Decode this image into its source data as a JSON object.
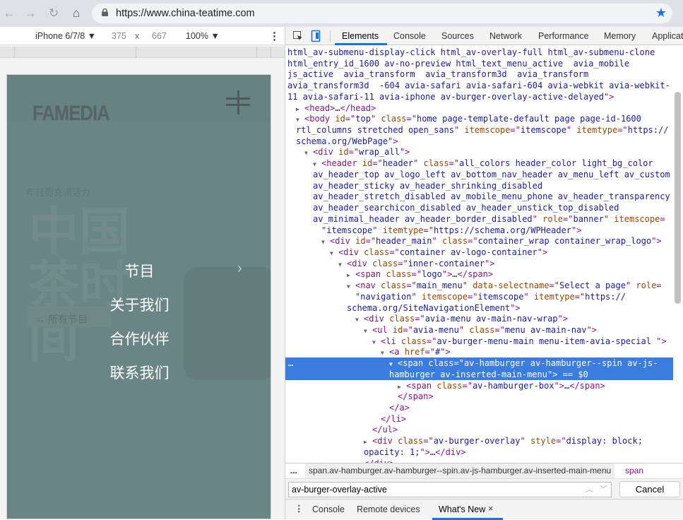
{
  "browser": {
    "url": "https://www.china-teatime.com",
    "back_icon": "arrow-left",
    "forward_icon": "arrow-right",
    "reload_icon": "reload",
    "home_icon": "home",
    "bookmark_icon": "star",
    "accent": "#1a73e8"
  },
  "device_toolbar": {
    "device": "iPhone 6/7/8 ▼",
    "width": "375",
    "x": "x",
    "height": "667",
    "zoom": "100% ▼",
    "more": "⋮"
  },
  "page": {
    "logo": "FAMEDIA",
    "tagline": "年轻而充满活力",
    "hero": "中国茶时间",
    "all_programs": "→ 所有节目",
    "overlay_color": "#6a8585",
    "menu": [
      {
        "label": "节目",
        "has_submenu": true,
        "chevron": "›"
      },
      {
        "label": "关于我们"
      },
      {
        "label": "合作伙伴"
      },
      {
        "label": "联系我们"
      }
    ]
  },
  "devtools": {
    "tabs": [
      "Elements",
      "Console",
      "Sources",
      "Network",
      "Performance",
      "Memory",
      "Applicat"
    ],
    "active_tab": "Elements",
    "lines": [
      {
        "d": 0,
        "s": [
          [
            "v",
            "html_av-submenu-display-click html_av-overlay-full html_av-submenu-clone"
          ]
        ]
      },
      {
        "d": 0,
        "s": [
          [
            "v",
            "html_entry_id_1600 av-no-preview html_text_menu_active  avia_mobile"
          ]
        ]
      },
      {
        "d": 0,
        "s": [
          [
            "v",
            "js_active  avia_transform  avia_transform3d  avia_transform"
          ]
        ]
      },
      {
        "d": 0,
        "s": [
          [
            "v",
            "avia_transform3d  -604 avia-safari avia-safari-604 avia-webkit avia-webkit-"
          ]
        ]
      },
      {
        "d": 0,
        "s": [
          [
            "v",
            "11 avia-safari-11 avia-iphone av-burger-overlay-active-delayed"
          ],
          [
            "t",
            "\">"
          ]
        ]
      },
      {
        "d": 1,
        "tri": "▶",
        "s": [
          [
            "t",
            "<head>"
          ],
          [
            "x",
            "…"
          ],
          [
            "t",
            "</head>"
          ]
        ]
      },
      {
        "d": 1,
        "tri": "▼",
        "s": [
          [
            "t",
            "<body "
          ],
          [
            "a",
            "id"
          ],
          [
            "t",
            "=\""
          ],
          [
            "v",
            "top"
          ],
          [
            "t",
            "\" "
          ],
          [
            "a",
            "class"
          ],
          [
            "t",
            "=\""
          ],
          [
            "v",
            "home page-template-default page page-id-1600"
          ]
        ]
      },
      {
        "d": 1,
        "s": [
          [
            "v",
            "rtl_columns stretched open_sans"
          ],
          [
            "t",
            "\" "
          ],
          [
            "a",
            "itemscope"
          ],
          [
            "t",
            "=\""
          ],
          [
            "v",
            "itemscope"
          ],
          [
            "t",
            "\" "
          ],
          [
            "a",
            "itemtype"
          ],
          [
            "t",
            "=\""
          ],
          [
            "v",
            "https://"
          ]
        ]
      },
      {
        "d": 1,
        "s": [
          [
            "v",
            "schema.org/WebPage"
          ],
          [
            "t",
            "\">"
          ]
        ]
      },
      {
        "d": 2,
        "tri": "▼",
        "s": [
          [
            "t",
            "<div "
          ],
          [
            "a",
            "id"
          ],
          [
            "t",
            "=\""
          ],
          [
            "v",
            "wrap_all"
          ],
          [
            "t",
            "\">"
          ]
        ]
      },
      {
        "d": 3,
        "tri": "▼",
        "s": [
          [
            "t",
            "<header "
          ],
          [
            "a",
            "id"
          ],
          [
            "t",
            "=\""
          ],
          [
            "v",
            "header"
          ],
          [
            "t",
            "\" "
          ],
          [
            "a",
            "class"
          ],
          [
            "t",
            "=\""
          ],
          [
            "v",
            "all_colors header_color light_bg_color"
          ]
        ]
      },
      {
        "d": 3,
        "s": [
          [
            "v",
            "av_header_top av_logo_left av_bottom_nav_header av_menu_left av_custom"
          ]
        ]
      },
      {
        "d": 3,
        "s": [
          [
            "v",
            "av_header_sticky av_header_shrinking_disabled"
          ]
        ]
      },
      {
        "d": 3,
        "s": [
          [
            "v",
            "av_header_stretch_disabled av_mobile_menu_phone av_header_transparency"
          ]
        ]
      },
      {
        "d": 3,
        "s": [
          [
            "v",
            "av_header_searchicon_disabled av_header_unstick_top_disabled"
          ]
        ]
      },
      {
        "d": 3,
        "s": [
          [
            "v",
            "av_minimal_header av_header_border_disabled"
          ],
          [
            "t",
            "\" "
          ],
          [
            "a",
            "role"
          ],
          [
            "t",
            "=\""
          ],
          [
            "v",
            "banner"
          ],
          [
            "t",
            "\" "
          ],
          [
            "a",
            "itemscope"
          ],
          [
            "t",
            "="
          ]
        ]
      },
      {
        "d": 3,
        "s": [
          [
            "t",
            "\""
          ],
          [
            "v",
            "itemscope"
          ],
          [
            "t",
            "\" "
          ],
          [
            "a",
            "itemtype"
          ],
          [
            "t",
            "=\""
          ],
          [
            "v",
            "https://schema.org/WPHeader"
          ],
          [
            "t",
            "\">"
          ]
        ]
      },
      {
        "d": 4,
        "tri": "▼",
        "s": [
          [
            "t",
            "<div "
          ],
          [
            "a",
            "id"
          ],
          [
            "t",
            "=\""
          ],
          [
            "v",
            "header_main"
          ],
          [
            "t",
            "\" "
          ],
          [
            "a",
            "class"
          ],
          [
            "t",
            "=\""
          ],
          [
            "v",
            "container_wrap container_wrap_logo"
          ],
          [
            "t",
            "\">"
          ]
        ]
      },
      {
        "d": 5,
        "tri": "▼",
        "s": [
          [
            "t",
            "<div "
          ],
          [
            "a",
            "class"
          ],
          [
            "t",
            "=\""
          ],
          [
            "v",
            "container av-logo-container"
          ],
          [
            "t",
            "\">"
          ]
        ]
      },
      {
        "d": 6,
        "tri": "▼",
        "s": [
          [
            "t",
            "<div "
          ],
          [
            "a",
            "class"
          ],
          [
            "t",
            "=\""
          ],
          [
            "v",
            "inner-container"
          ],
          [
            "t",
            "\">"
          ]
        ]
      },
      {
        "d": 7,
        "tri": "▶",
        "s": [
          [
            "t",
            "<span "
          ],
          [
            "a",
            "class"
          ],
          [
            "t",
            "=\""
          ],
          [
            "v",
            "logo"
          ],
          [
            "t",
            "\">"
          ],
          [
            "x",
            "…"
          ],
          [
            "t",
            "</span>"
          ]
        ]
      },
      {
        "d": 7,
        "tri": "▼",
        "s": [
          [
            "t",
            "<nav "
          ],
          [
            "a",
            "class"
          ],
          [
            "t",
            "=\""
          ],
          [
            "v",
            "main_menu"
          ],
          [
            "t",
            "\" "
          ],
          [
            "a",
            "data-selectname"
          ],
          [
            "t",
            "=\""
          ],
          [
            "v",
            "Select a page"
          ],
          [
            "t",
            "\" "
          ],
          [
            "a",
            "role"
          ],
          [
            "t",
            "="
          ]
        ]
      },
      {
        "d": 7,
        "s": [
          [
            "t",
            "\""
          ],
          [
            "v",
            "navigation"
          ],
          [
            "t",
            "\" "
          ],
          [
            "a",
            "itemscope"
          ],
          [
            "t",
            "=\""
          ],
          [
            "v",
            "itemscope"
          ],
          [
            "t",
            "\" "
          ],
          [
            "a",
            "itemtype"
          ],
          [
            "t",
            "=\""
          ],
          [
            "v",
            "https://"
          ]
        ]
      },
      {
        "d": 7,
        "s": [
          [
            "v",
            "schema.org/SiteNavigationElement"
          ],
          [
            "t",
            "\">"
          ]
        ]
      },
      {
        "d": 8,
        "tri": "▼",
        "s": [
          [
            "t",
            "<div "
          ],
          [
            "a",
            "class"
          ],
          [
            "t",
            "=\""
          ],
          [
            "v",
            "avia-menu av-main-nav-wrap"
          ],
          [
            "t",
            "\">"
          ]
        ]
      },
      {
        "d": 9,
        "tri": "▼",
        "s": [
          [
            "t",
            "<ul "
          ],
          [
            "a",
            "id"
          ],
          [
            "t",
            "=\""
          ],
          [
            "v",
            "avia-menu"
          ],
          [
            "t",
            "\" "
          ],
          [
            "a",
            "class"
          ],
          [
            "t",
            "=\""
          ],
          [
            "v",
            "menu av-main-nav"
          ],
          [
            "t",
            "\">"
          ]
        ]
      },
      {
        "d": 10,
        "tri": "▼",
        "s": [
          [
            "t",
            "<li "
          ],
          [
            "a",
            "class"
          ],
          [
            "t",
            "=\""
          ],
          [
            "v",
            "av-burger-menu-main menu-item-avia-special "
          ],
          [
            "t",
            "\">"
          ]
        ]
      },
      {
        "d": 11,
        "tri": "▼",
        "s": [
          [
            "t",
            "<a "
          ],
          [
            "a",
            "href"
          ],
          [
            "t",
            "=\""
          ],
          [
            "v",
            "#"
          ],
          [
            "t",
            "\">"
          ]
        ]
      },
      {
        "d": 12,
        "tri": "▼",
        "sel": true,
        "s": [
          [
            "t",
            "<span "
          ],
          [
            "a",
            "class"
          ],
          [
            "t",
            "=\""
          ],
          [
            "v",
            "av-hamburger av-hamburger--spin av-js-"
          ]
        ]
      },
      {
        "d": 12,
        "sel": true,
        "s": [
          [
            "v",
            "hamburger av-inserted-main-menu"
          ],
          [
            "t",
            "\">"
          ],
          [
            "c",
            " == $0"
          ]
        ]
      },
      {
        "d": 13,
        "tri": "▶",
        "s": [
          [
            "t",
            "<span "
          ],
          [
            "a",
            "class"
          ],
          [
            "t",
            "=\""
          ],
          [
            "v",
            "av-hamburger-box"
          ],
          [
            "t",
            "\">"
          ],
          [
            "x",
            "…"
          ],
          [
            "t",
            "</span>"
          ]
        ]
      },
      {
        "d": 12,
        "s": [
          [
            "t",
            "</span>"
          ]
        ]
      },
      {
        "d": 11,
        "s": [
          [
            "t",
            "</a>"
          ]
        ]
      },
      {
        "d": 10,
        "s": [
          [
            "t",
            "</li>"
          ]
        ]
      },
      {
        "d": 9,
        "s": [
          [
            "t",
            "</ul>"
          ]
        ]
      },
      {
        "d": 9,
        "tri": "▶",
        "s": [
          [
            "t",
            "<div "
          ],
          [
            "a",
            "class"
          ],
          [
            "t",
            "=\""
          ],
          [
            "v",
            "av-burger-overlay"
          ],
          [
            "t",
            "\" "
          ],
          [
            "a",
            "style"
          ],
          [
            "t",
            "=\""
          ],
          [
            "v",
            "display: block;"
          ]
        ]
      },
      {
        "d": 9,
        "s": [
          [
            "v",
            "opacity: 1;"
          ],
          [
            "t",
            "\">"
          ],
          [
            "x",
            "…"
          ],
          [
            "t",
            "</div>"
          ]
        ]
      },
      {
        "d": 8,
        "s": [
          [
            "t",
            "</div>"
          ]
        ]
      }
    ],
    "breadcrumb": {
      "more": "...",
      "path": "span.av-hamburger.av-hamburger--spin.av-js-hamburger.av-inserted-main-menu",
      "last": "span"
    },
    "search": {
      "value": "av-burger-overlay-active",
      "cancel": "Cancel"
    },
    "drawer": {
      "tabs": [
        "Console",
        "Remote devices",
        "What's New"
      ],
      "active": "What's New",
      "close": "×"
    },
    "selection_color": "#3b7ddd"
  }
}
